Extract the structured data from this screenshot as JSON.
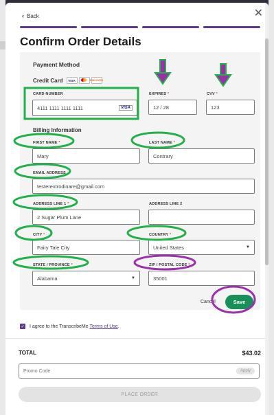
{
  "nav": {
    "back_label": "Back",
    "close_icon": "close-icon"
  },
  "page_title": "Confirm Order Details",
  "payment": {
    "section_label": "Payment Method",
    "method_label": "Credit Card",
    "card_logos": [
      "VISA",
      "MC",
      "DISCOVER"
    ],
    "card_number": {
      "label": "CARD NUMBER",
      "value": "4111 1111 1111 1111",
      "brand": "VISA"
    },
    "expires": {
      "label": "EXPIRES",
      "value": "12 / 28"
    },
    "cvv": {
      "label": "CVV",
      "value": "123"
    }
  },
  "billing": {
    "section_label": "Billing Information",
    "first_name": {
      "label": "FIRST NAME",
      "value": "Mary"
    },
    "last_name": {
      "label": "LAST NAME",
      "value": "Contrary"
    },
    "email": {
      "label": "EMAIL ADDRESS",
      "value": "testerextrodinare@gmail.com"
    },
    "address1": {
      "label": "ADDRESS LINE 1",
      "value": "2 Sugar Plum Lane"
    },
    "address2": {
      "label": "ADDRESS LINE 2",
      "value": ""
    },
    "city": {
      "label": "CITY",
      "value": "Fairy Tale City"
    },
    "country": {
      "label": "COUNTRY",
      "value": "United States"
    },
    "state": {
      "label": "STATE / PROVINCE",
      "value": "Alabama"
    },
    "zip": {
      "label": "ZIP / POSTAL CODE",
      "value": "35001"
    },
    "required_mark": "*"
  },
  "actions": {
    "cancel_label": "Cancel",
    "save_label": "Save"
  },
  "terms": {
    "prefix": "I agree to the TranscribeMe",
    "link": "Terms of Use",
    "suffix": "."
  },
  "summary": {
    "total_label": "TOTAL",
    "total_value": "$43.02",
    "promo_placeholder": "Promo Code",
    "apply_label": "Apply",
    "place_order_label": "PLACE ORDER"
  },
  "colors": {
    "brand_purple": "#5c3a8f",
    "save_green": "#1a8f5a",
    "annotation_green": "#22b04a",
    "annotation_purple": "#9b30a8"
  }
}
